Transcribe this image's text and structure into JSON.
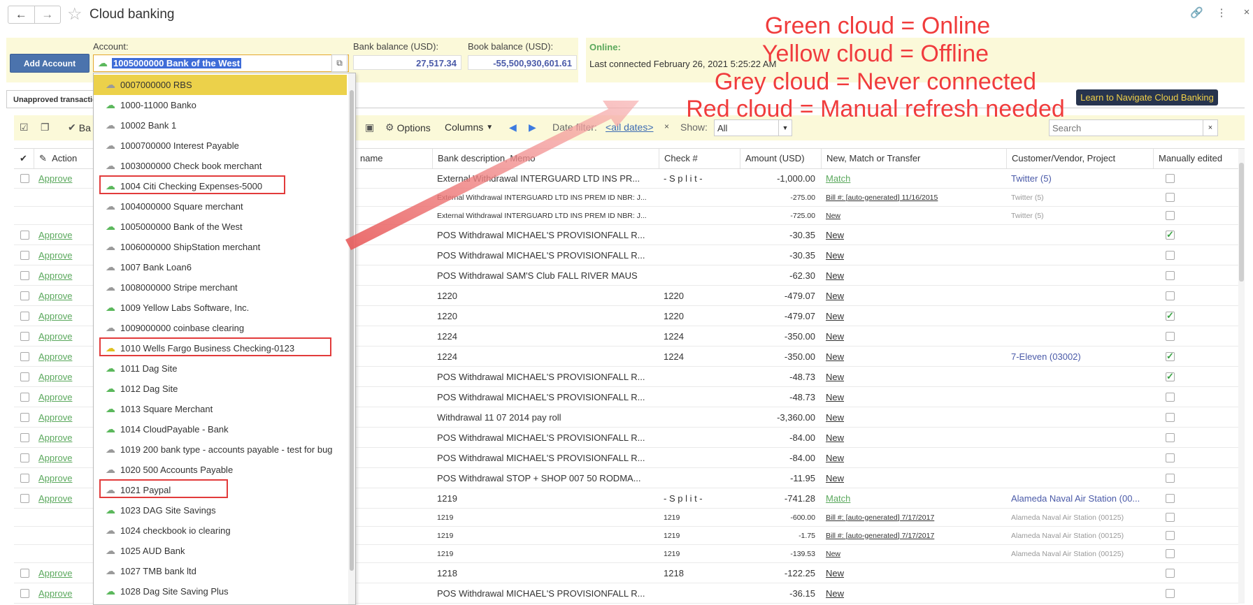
{
  "header": {
    "title": "Cloud banking",
    "back_icon": "←",
    "forward_icon": "→",
    "star_icon": "☆",
    "link_icon": "🔗",
    "more_icon": "⋮",
    "close_icon": "×"
  },
  "account_panel": {
    "add_account_label": "Add Account",
    "account_label": "Account:",
    "account_value": "1005000000 Bank of the West",
    "bank_balance_label": "Bank balance (USD):",
    "bank_balance": "27,517.34",
    "book_balance_label": "Book balance (USD):",
    "book_balance": "-55,500,930,601.61",
    "online_label": "Online:",
    "last_connected": "Last connected February 26, 2021 5:25:22 AM"
  },
  "tabs": {
    "active": "Unapproved transactions"
  },
  "learn_button": "Learn to Navigate Cloud Banking",
  "toolbar": {
    "batch_label": "Ba",
    "options_label": "Options",
    "columns_label": "Columns",
    "date_filter_label": "Date filter:",
    "date_filter_value": "<all dates>",
    "show_label": "Show:",
    "show_value": "All",
    "search_placeholder": "Search"
  },
  "table": {
    "headers": {
      "action": "Action",
      "name": "name",
      "description": "Bank description, Memo",
      "check": "Check #",
      "amount": "Amount (USD)",
      "match": "New, Match or Transfer",
      "customer": "Customer/Vendor, Project",
      "edited": "Manually edited"
    },
    "rows": [
      {
        "approve": "Approve",
        "desc": "External Withdrawal INTERGUARD LTD INS PR...",
        "check": "- S p l i t -",
        "amount": "-1,000.00",
        "match": "Match",
        "customer": "Twitter (5)",
        "edited": false,
        "small": false
      },
      {
        "approve": "",
        "desc": "External Withdrawal INTERGUARD LTD INS PREM ID NBR: J...",
        "check": "",
        "amount": "-275.00",
        "match": "Bill #: [auto-generated] 11/16/2015",
        "customer": "Twitter (5)",
        "edited": false,
        "small": true
      },
      {
        "approve": "",
        "desc": "External Withdrawal INTERGUARD LTD INS PREM ID NBR: J...",
        "check": "",
        "amount": "-725.00",
        "match": "New",
        "customer": "Twitter (5)",
        "edited": false,
        "small": true
      },
      {
        "approve": "Approve",
        "desc": "POS Withdrawal MICHAEL'S PROVISIONFALL R...",
        "check": "",
        "amount": "-30.35",
        "match": "New",
        "customer": "",
        "edited": true,
        "small": false
      },
      {
        "approve": "Approve",
        "desc": "POS Withdrawal MICHAEL'S PROVISIONFALL R...",
        "check": "",
        "amount": "-30.35",
        "match": "New",
        "customer": "",
        "edited": false,
        "small": false
      },
      {
        "approve": "Approve",
        "desc": "POS Withdrawal SAM'S Club FALL RIVER MAUS",
        "check": "",
        "amount": "-62.30",
        "match": "New",
        "customer": "",
        "edited": false,
        "small": false
      },
      {
        "approve": "Approve",
        "desc": "1220",
        "check": "1220",
        "amount": "-479.07",
        "match": "New",
        "customer": "",
        "edited": false,
        "small": false
      },
      {
        "approve": "Approve",
        "desc": "1220",
        "check": "1220",
        "amount": "-479.07",
        "match": "New",
        "customer": "",
        "edited": true,
        "small": false
      },
      {
        "approve": "Approve",
        "desc": "1224",
        "check": "1224",
        "amount": "-350.00",
        "match": "New",
        "customer": "",
        "edited": false,
        "small": false
      },
      {
        "approve": "Approve",
        "desc": "1224",
        "check": "1224",
        "amount": "-350.00",
        "match": "New",
        "customer": "7-Eleven (03002)",
        "edited": true,
        "small": false
      },
      {
        "approve": "Approve",
        "desc": "POS Withdrawal MICHAEL'S PROVISIONFALL R...",
        "check": "",
        "amount": "-48.73",
        "match": "New",
        "customer": "",
        "edited": true,
        "small": false
      },
      {
        "approve": "Approve",
        "desc": "POS Withdrawal MICHAEL'S PROVISIONFALL R...",
        "check": "",
        "amount": "-48.73",
        "match": "New",
        "customer": "",
        "edited": false,
        "small": false
      },
      {
        "approve": "Approve",
        "desc": "Withdrawal 11 07 2014 pay roll",
        "check": "",
        "amount": "-3,360.00",
        "match": "New",
        "customer": "",
        "edited": false,
        "small": false
      },
      {
        "approve": "Approve",
        "desc": "POS Withdrawal MICHAEL'S PROVISIONFALL R...",
        "check": "",
        "amount": "-84.00",
        "match": "New",
        "customer": "",
        "edited": false,
        "small": false
      },
      {
        "approve": "Approve",
        "desc": "POS Withdrawal MICHAEL'S PROVISIONFALL R...",
        "check": "",
        "amount": "-84.00",
        "match": "New",
        "customer": "",
        "edited": false,
        "small": false
      },
      {
        "approve": "Approve",
        "desc": "POS Withdrawal STOP + SHOP 007 50 RODMA...",
        "check": "",
        "amount": "-11.95",
        "match": "New",
        "customer": "",
        "edited": false,
        "small": false
      },
      {
        "approve": "Approve",
        "desc": "1219",
        "check": "- S p l i t -",
        "amount": "-741.28",
        "match": "Match",
        "customer": "Alameda Naval Air Station (00...",
        "edited": false,
        "small": false
      },
      {
        "approve": "",
        "desc": "1219",
        "check": "1219",
        "amount": "-600.00",
        "match": "Bill #: [auto-generated] 7/17/2017",
        "customer": "Alameda Naval Air Station (00125)",
        "edited": false,
        "small": true
      },
      {
        "approve": "",
        "desc": "1219",
        "check": "1219",
        "amount": "-1.75",
        "match": "Bill #: [auto-generated] 7/17/2017",
        "customer": "Alameda Naval Air Station (00125)",
        "edited": false,
        "small": true
      },
      {
        "approve": "",
        "desc": "1219",
        "check": "1219",
        "amount": "-139.53",
        "match": "New",
        "customer": "Alameda Naval Air Station (00125)",
        "edited": false,
        "small": true
      },
      {
        "approve": "Approve",
        "desc": "1218",
        "check": "1218",
        "amount": "-122.25",
        "match": "New",
        "customer": "",
        "edited": false,
        "small": false
      },
      {
        "approve": "Approve",
        "desc": "POS Withdrawal MICHAEL'S PROVISIONFALL R...",
        "check": "",
        "amount": "-36.15",
        "match": "New",
        "customer": "",
        "edited": false,
        "small": false
      }
    ]
  },
  "dropdown": {
    "items": [
      {
        "label": "0007000000 RBS",
        "cloud": "grey",
        "selected": true
      },
      {
        "label": "1000-11000 Banko",
        "cloud": "green"
      },
      {
        "label": "10002 Bank 1",
        "cloud": "grey"
      },
      {
        "label": "1000700000 Interest Payable",
        "cloud": "grey"
      },
      {
        "label": "1003000000 Check book merchant",
        "cloud": "grey"
      },
      {
        "label": "1004 Citi Checking Expenses-5000",
        "cloud": "green",
        "boxed": true
      },
      {
        "label": "1004000000 Square merchant",
        "cloud": "grey"
      },
      {
        "label": "1005000000 Bank of the West",
        "cloud": "green"
      },
      {
        "label": "1006000000 ShipStation merchant",
        "cloud": "grey"
      },
      {
        "label": "1007 Bank Loan6",
        "cloud": "grey"
      },
      {
        "label": "1008000000 Stripe merchant",
        "cloud": "grey"
      },
      {
        "label": "1009 Yellow Labs Software, Inc.",
        "cloud": "green"
      },
      {
        "label": "1009000000 coinbase clearing",
        "cloud": "grey"
      },
      {
        "label": "1010 Wells Fargo Business Checking-0123",
        "cloud": "yellow",
        "boxed": true
      },
      {
        "label": "1011 Dag Site",
        "cloud": "green"
      },
      {
        "label": "1012 Dag Site",
        "cloud": "green"
      },
      {
        "label": "1013 Square Merchant",
        "cloud": "green"
      },
      {
        "label": "1014 CloudPayable - Bank",
        "cloud": "green"
      },
      {
        "label": "1019 200 bank type - accounts payable - test for bug",
        "cloud": "grey"
      },
      {
        "label": "1020 500 Accounts Payable",
        "cloud": "grey"
      },
      {
        "label": "1021 Paypal",
        "cloud": "grey",
        "boxed": true
      },
      {
        "label": "1023 DAG Site Savings",
        "cloud": "green"
      },
      {
        "label": "1024 checkbook io clearing",
        "cloud": "grey"
      },
      {
        "label": "1025 AUD Bank",
        "cloud": "grey"
      },
      {
        "label": "1027 TMB bank ltd",
        "cloud": "grey"
      },
      {
        "label": "1028 Dag Site Saving Plus",
        "cloud": "green"
      }
    ],
    "cloud_colors": {
      "green": "#5bb85c",
      "grey": "#9a9a9a",
      "yellow": "#e0c020",
      "red": "#e04040"
    }
  },
  "annotations": {
    "line1": "Green cloud = Online",
    "line2": "Yellow cloud = Offline",
    "line3": "Grey cloud = Never connected",
    "line4": "Red cloud = Manual refresh needed"
  }
}
